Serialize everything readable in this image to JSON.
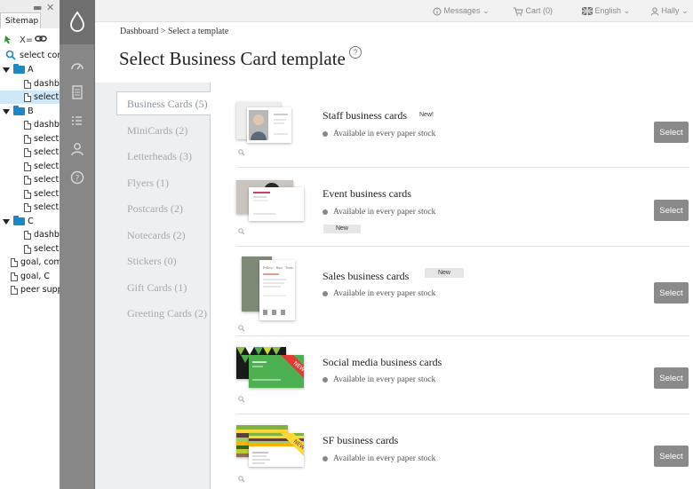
{
  "sitemap": {
    "tab": "Sitemap",
    "items": [
      {
        "label": "select cor"
      },
      {
        "label": "A"
      },
      {
        "label": "dashbo"
      },
      {
        "label": "select"
      },
      {
        "label": "B"
      },
      {
        "label": "dashbo"
      },
      {
        "label": "select"
      },
      {
        "label": "select"
      },
      {
        "label": "select"
      },
      {
        "label": "select"
      },
      {
        "label": "select"
      },
      {
        "label": "select"
      },
      {
        "label": "C"
      },
      {
        "label": "dashbo"
      },
      {
        "label": "select"
      },
      {
        "label": "goal, com"
      },
      {
        "label": "goal, C"
      },
      {
        "label": "peer supp"
      }
    ]
  },
  "topbar": {
    "messages": "Messages",
    "cart": "Cart (0)",
    "language": "English",
    "user": "Hally"
  },
  "breadcrumb": "Dashboard > Select a template",
  "page_title": "Select Business Card template",
  "help_glyph": "?",
  "categories": [
    {
      "label": "Business Cards (5)"
    },
    {
      "label": "MiniCards (2)"
    },
    {
      "label": "Letterheads (3)"
    },
    {
      "label": "Flyers (1)"
    },
    {
      "label": "Postcards (2)"
    },
    {
      "label": "Notecards (2)"
    },
    {
      "label": "Stickers (0)"
    },
    {
      "label": "Gift Cards (1)"
    },
    {
      "label": "Greeting Cards (2)"
    }
  ],
  "templates": [
    {
      "name": "Staff business cards",
      "availability": "Available in every paper stock",
      "badge": "New!",
      "select": "Select"
    },
    {
      "name": "Event business cards",
      "availability": "Available in every paper stock",
      "badge": "New",
      "select": "Select"
    },
    {
      "name": "Sales business cards",
      "availability": "Available in every paper stock",
      "badge": "New",
      "select": "Select"
    },
    {
      "name": "Social media business cards",
      "availability": "Available in every paper stock",
      "select": "Select"
    },
    {
      "name": "SF business cards",
      "availability": "Available in every paper stock",
      "select": "Select"
    }
  ],
  "thumbnails": {
    "ribbon": "NEW",
    "sales_card_header": "Pellow · Rust · Team"
  },
  "colors": {
    "sidebar": "#878787",
    "category_panel": "#edf0f3",
    "select_button": "#8a8a8a",
    "sitemap_selection": "#cfe8f7",
    "folder": "#1e88c7"
  }
}
